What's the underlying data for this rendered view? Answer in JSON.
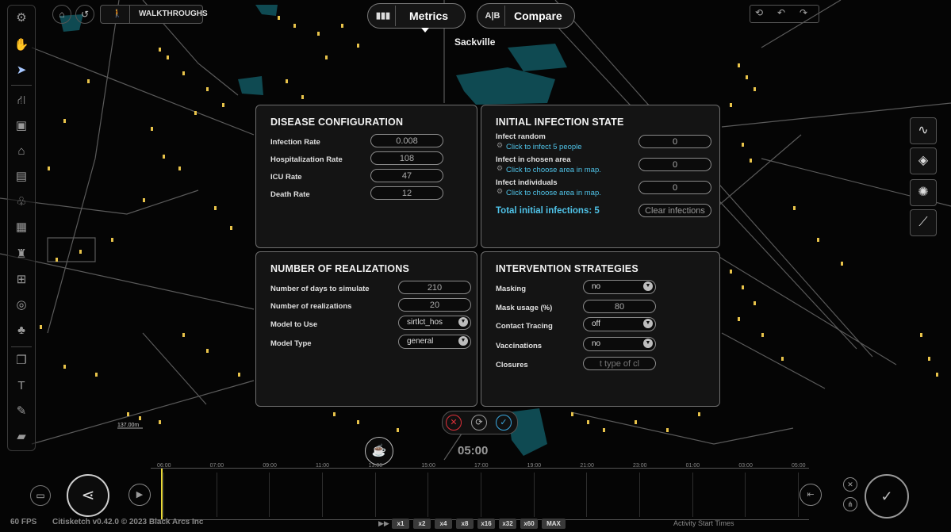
{
  "toolbar": {
    "walkthroughs_label": "WALKTHROUGHS",
    "metrics_icon": "bar-chart-icon",
    "metrics_label": "Metrics",
    "compare_icon_text": "A|B",
    "compare_label": "Compare"
  },
  "map": {
    "town_label": "Sackville",
    "scale_label": "137.00m",
    "clock": "05:00"
  },
  "disease_config": {
    "title": "DISEASE CONFIGURATION",
    "rows": [
      {
        "label": "Infection Rate",
        "value": "0.008"
      },
      {
        "label": "Hospitalization Rate",
        "value": "108"
      },
      {
        "label": "ICU Rate",
        "value": "47"
      },
      {
        "label": "Death Rate",
        "value": "12"
      }
    ]
  },
  "initial_infection": {
    "title": "INITIAL INFECTION STATE",
    "rows": [
      {
        "label": "Infect random",
        "link": "Click to infect 5 people",
        "value": "0"
      },
      {
        "label": "Infect in chosen area",
        "link": "Click to choose area in map.",
        "value": "0"
      },
      {
        "label": "Infect individuals",
        "link": "Click to choose area in map.",
        "value": "0"
      }
    ],
    "total_label": "Total initial infections: 5",
    "clear_button": "Clear infections"
  },
  "realizations": {
    "title": "NUMBER OF REALIZATIONS",
    "days_label": "Number of days to simulate",
    "days_value": "210",
    "realizations_label": "Number of realizations",
    "realizations_value": "20",
    "model_label": "Model to Use",
    "model_value": "sirtlct_hos",
    "model_type_label": "Model Type",
    "model_type_value": "general"
  },
  "interventions": {
    "title": "INTERVENTION STRATEGIES",
    "masking_label": "Masking",
    "masking_value": "no",
    "mask_usage_label": "Mask usage (%)",
    "mask_usage_value": "80",
    "contact_tracing_label": "Contact Tracing",
    "contact_tracing_value": "off",
    "vaccinations_label": "Vaccinations",
    "vaccinations_value": "no",
    "closures_label": "Closures",
    "closures_placeholder": "t type of cl"
  },
  "timeline": {
    "ticks": [
      "06:00",
      "07:00",
      "09:00",
      "11:00",
      "13:00",
      "15:00",
      "17:00",
      "19:00",
      "21:00",
      "23:00",
      "01:00",
      "03:00",
      "05:00"
    ],
    "activity_label": "Activity Start Times"
  },
  "footer": {
    "fps": "60 FPS",
    "version": "Citisketch v0.42.0 © 2023 Black Arcs Inc",
    "speeds": [
      "x1",
      "x2",
      "x4",
      "x8",
      "x16",
      "x32",
      "x60",
      "MAX"
    ]
  },
  "colors": {
    "accent_link": "#4fc3e8",
    "building": "#e8c34a",
    "water": "#0f4a52"
  }
}
